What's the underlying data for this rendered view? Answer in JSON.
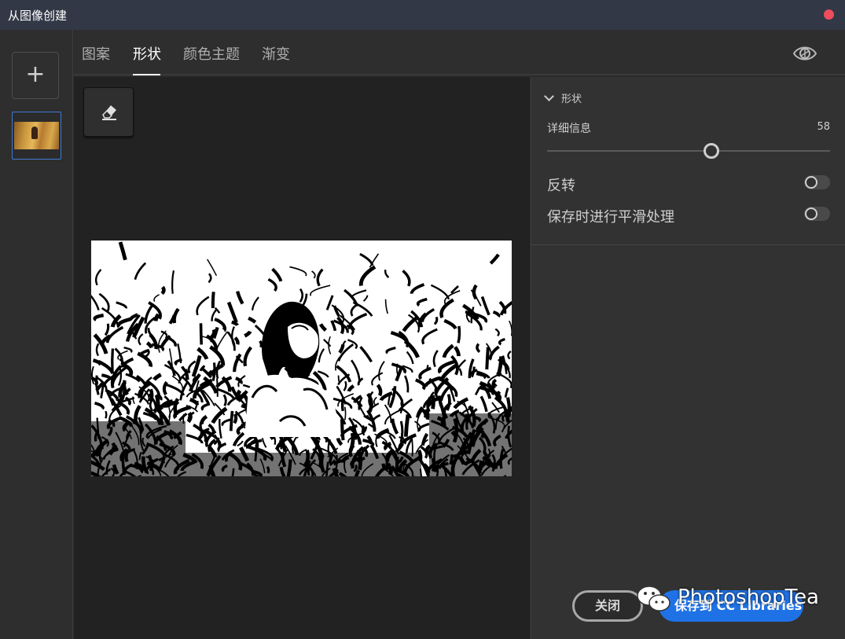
{
  "window": {
    "title": "从图像创建"
  },
  "tabs": [
    {
      "label": "图案"
    },
    {
      "label": "形状",
      "active": true
    },
    {
      "label": "颜色主题"
    },
    {
      "label": "渐变"
    }
  ],
  "panel": {
    "section_title": "形状",
    "detail": {
      "label": "详细信息",
      "value": "58",
      "fraction": 0.58
    },
    "invert": {
      "label": "反转",
      "enabled": false
    },
    "smooth": {
      "label": "保存时进行平滑处理",
      "enabled": false
    }
  },
  "footer": {
    "close_label": "关闭",
    "save_label": "保存到 CC Libraries"
  },
  "watermark": {
    "text": "PhotoshopTea"
  },
  "colors": {
    "accent": "#1f72e6",
    "close_dot": "#ee4d5b",
    "selected_border": "#3e7ad6"
  },
  "icons": [
    "plus-icon",
    "eye-icon",
    "eraser-icon",
    "wechat-icon"
  ]
}
